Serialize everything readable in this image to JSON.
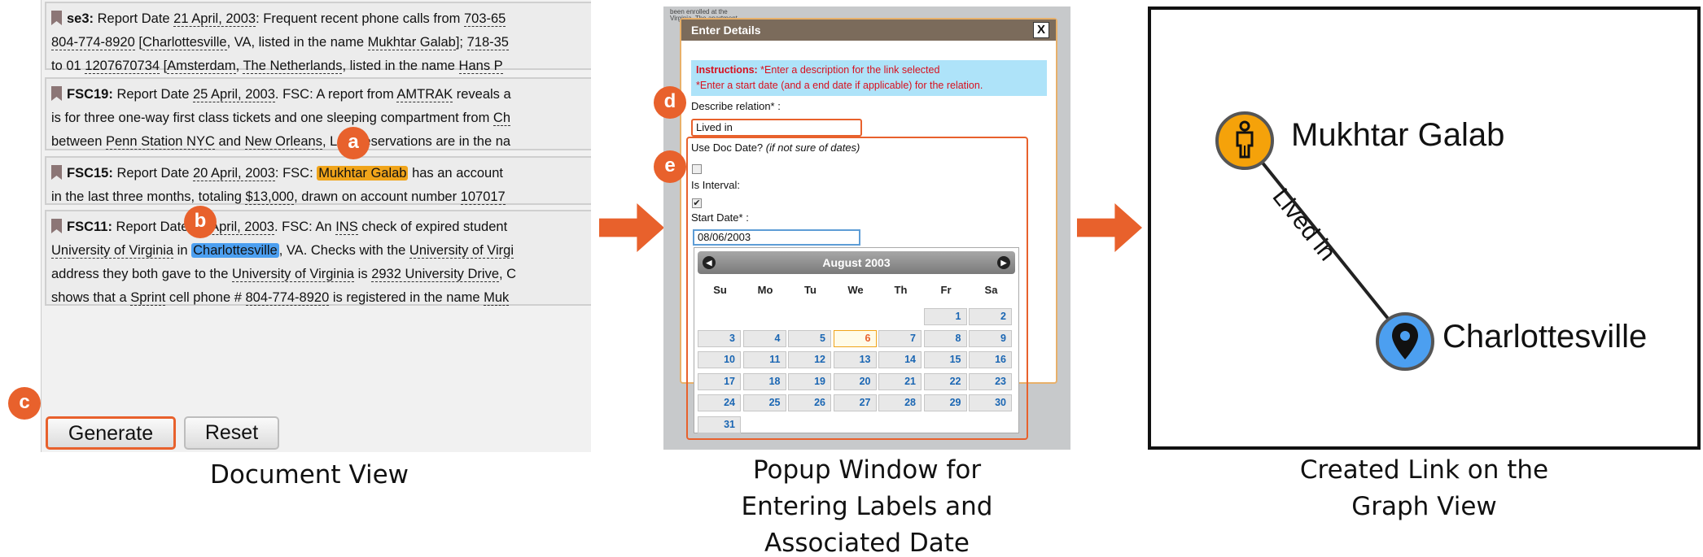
{
  "document_view": {
    "items": [
      {
        "id": "se3",
        "segments": [
          [
            {
              "t": "se3:",
              "c": "sid"
            },
            {
              "t": " Report Date "
            },
            {
              "t": "21 April, 2003",
              "c": "dl"
            },
            {
              "t": ": Frequent recent phone calls from "
            },
            {
              "t": "703-65",
              "c": "dl"
            }
          ],
          [
            {
              "t": "804-774-8920",
              "c": "dl"
            },
            {
              "t": " ["
            },
            {
              "t": "Charlottesville",
              "c": "dl"
            },
            {
              "t": ", VA, listed in the name "
            },
            {
              "t": "Mukhtar Galab",
              "c": "dl"
            },
            {
              "t": "]; "
            },
            {
              "t": "718-35",
              "c": "dl"
            }
          ],
          [
            {
              "t": "to 01 "
            },
            {
              "t": "1207670734",
              "c": "dl"
            },
            {
              "t": " ["
            },
            {
              "t": "Amsterdam",
              "c": "dl"
            },
            {
              "t": ", "
            },
            {
              "t": "The Netherlands",
              "c": "dl"
            },
            {
              "t": ", listed in the name "
            },
            {
              "t": "Hans P",
              "c": "dl"
            }
          ]
        ]
      },
      {
        "id": "FSC19",
        "segments": [
          [
            {
              "t": "FSC19:",
              "c": "sid"
            },
            {
              "t": " Report Date "
            },
            {
              "t": "25 April, 2003",
              "c": "dl"
            },
            {
              "t": ". FSC: A report from "
            },
            {
              "t": "AMTRAK",
              "c": "dl"
            },
            {
              "t": " reveals a"
            }
          ],
          [
            {
              "t": "is for three one-way first class tickets and one sleeping compartment from "
            },
            {
              "t": "Ch",
              "c": "dl"
            }
          ],
          [
            {
              "t": "between "
            },
            {
              "t": "Penn Station NYC",
              "c": "dl"
            },
            {
              "t": " and "
            },
            {
              "t": "New Orleans",
              "c": "dl"
            },
            {
              "t": ", LA. Reservations are in the na"
            }
          ]
        ]
      },
      {
        "id": "FSC15",
        "segments": [
          [
            {
              "t": "FSC15:",
              "c": "sid"
            },
            {
              "t": " Report Date "
            },
            {
              "t": "20 April, 2003",
              "c": "dl"
            },
            {
              "t": ": FSC: "
            },
            {
              "t": "Mukhtar Galab",
              "c": "hl-orange"
            },
            {
              "t": " has an account "
            }
          ],
          [
            {
              "t": "in the last three months, totaling "
            },
            {
              "t": "$13,000",
              "c": "dl"
            },
            {
              "t": ", drawn on account number "
            },
            {
              "t": "107017",
              "c": "dl"
            }
          ]
        ]
      },
      {
        "id": "FSC11",
        "segments": [
          [
            {
              "t": "FSC11:",
              "c": "sid"
            },
            {
              "t": " Report Date "
            },
            {
              "t": "18 April, 2003",
              "c": "dl"
            },
            {
              "t": ". FSC: An "
            },
            {
              "t": "INS",
              "c": "dl"
            },
            {
              "t": " check of expired student"
            }
          ],
          [
            {
              "t": "University of Virginia",
              "c": "dl"
            },
            {
              "t": " in "
            },
            {
              "t": "Charlottesville",
              "c": "hl-blue"
            },
            {
              "t": ", VA. Checks with the "
            },
            {
              "t": "University of Virgi",
              "c": "dl"
            }
          ],
          [
            {
              "t": "address they both gave to the "
            },
            {
              "t": "University of Virginia",
              "c": "dl"
            },
            {
              "t": " is "
            },
            {
              "t": "2932 University Drive",
              "c": "dl"
            },
            {
              "t": ", C"
            }
          ],
          [
            {
              "t": "shows that a "
            },
            {
              "t": "Sprint",
              "c": "dl"
            },
            {
              "t": " cell phone # "
            },
            {
              "t": "804-774-8920",
              "c": "dl"
            },
            {
              "t": " is registered in the name "
            },
            {
              "t": "Muk",
              "c": "dl"
            }
          ]
        ]
      }
    ],
    "generate_label": "Generate",
    "reset_label": "Reset",
    "caption": "Document View"
  },
  "badges": {
    "a": "a",
    "b": "b",
    "c": "c",
    "d": "d",
    "e": "e"
  },
  "popup": {
    "title": "Enter Details",
    "close": "X",
    "peek_text_1": "been enrolled at the",
    "peek_text_2": "Virginia. The apartment",
    "instructions_label": "Instructions:",
    "instruction_1": " *Enter a description for the link selected",
    "instruction_2": "*Enter a start date (and a end date if applicable) for the relation.",
    "describe_label": "Describe relation* :",
    "relation_value": "Lived in",
    "use_doc_date_label": "Use Doc Date?",
    "use_doc_date_hint": "(if not sure of dates)",
    "is_interval_label": "Is Interval:",
    "start_date_label": "Start Date* :",
    "start_date_value": "08/06/2003",
    "use_doc_date_checked": false,
    "is_interval_checked": true,
    "calendar": {
      "month": "August 2003",
      "prev": "◀",
      "next": "▶",
      "weekdays": [
        "Su",
        "Mo",
        "Tu",
        "We",
        "Th",
        "Fr",
        "Sa"
      ],
      "first_weekday": 5,
      "days_in_month": 31,
      "selected": 6
    },
    "caption": "Popup Window for\nEntering Labels and\nAssociated Date"
  },
  "graph": {
    "source": "Mukhtar Galab",
    "target": "Charlottesville",
    "edge_label": "Lived in",
    "source_color": "#f5a20a",
    "target_color": "#4c9ff0",
    "source_icon": "person-icon",
    "target_icon": "map-pin-icon",
    "caption": "Created Link on the\nGraph View"
  },
  "colors": {
    "accent": "#e8612c"
  }
}
